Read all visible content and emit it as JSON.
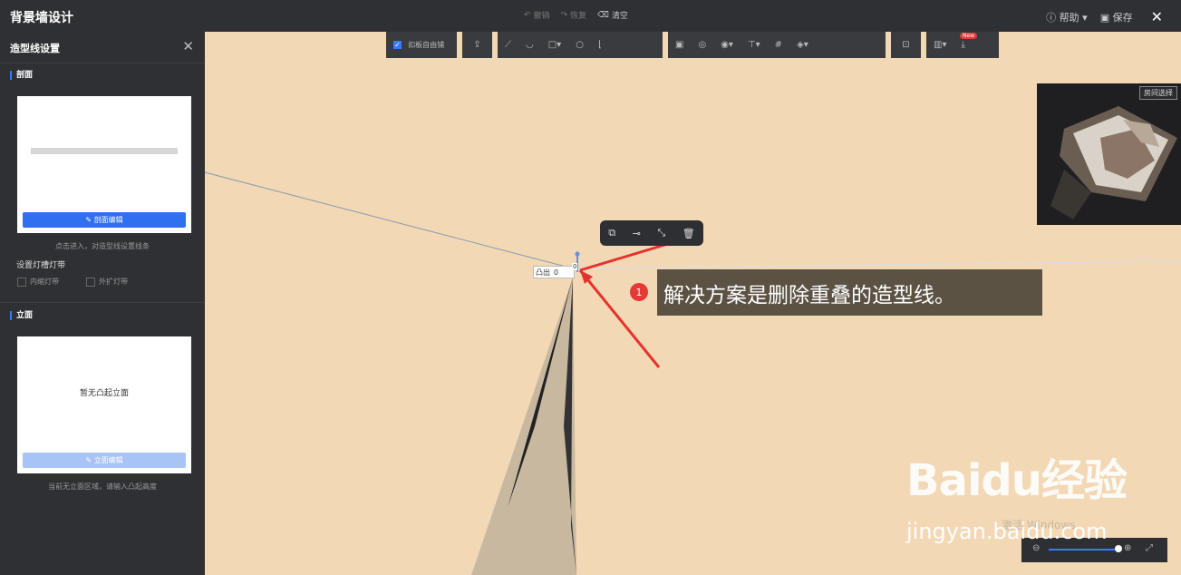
{
  "app": {
    "title": "背景墙设计"
  },
  "topbar": {
    "undo": "撤销",
    "redo": "恢复",
    "clear": "清空",
    "help": "帮助",
    "save": "保存"
  },
  "sidebar": {
    "title": "造型线设置",
    "section1": "剖面",
    "section1_button": "剖面编辑",
    "section1_hint": "点击进入，对造型线设置线条",
    "light_title": "设置灯槽灯带",
    "light_opt1": "内缩灯带",
    "light_opt2": "外扩灯带",
    "section2": "立面",
    "section2_empty": "暂无凸起立面",
    "section2_button": "立面编辑",
    "section2_hint": "当前无立面区域，请输入凸起高度"
  },
  "toolbar": {
    "snap": "扣板自由铺",
    "new_badge": "New"
  },
  "canvas": {
    "convex_label": "凸出",
    "convex_value": "0",
    "dim_value": "0",
    "annotation_number": "1",
    "annotation_text": "解决方案是删除重叠的造型线。"
  },
  "minimap": {
    "room_select": "房间选择"
  },
  "watermark": {
    "logo": "Baidu经验",
    "url": "jingyan.baidu.com",
    "windows": "激活 Windows"
  }
}
